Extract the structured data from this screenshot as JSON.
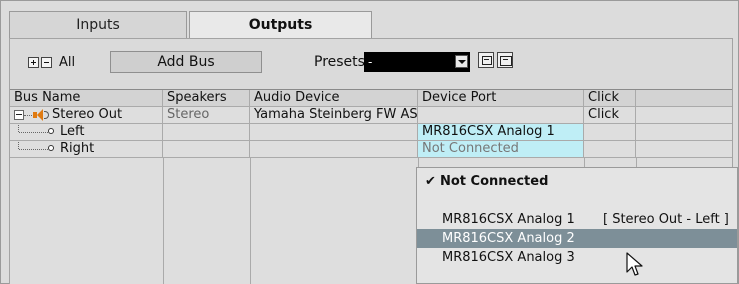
{
  "tabs": [
    {
      "label": "Inputs",
      "active": false
    },
    {
      "label": "Outputs",
      "active": true
    }
  ],
  "toolbar": {
    "all_label": "All",
    "add_bus_label": "Add Bus",
    "presets_label": "Presets",
    "preset_value": "-"
  },
  "table": {
    "headers": [
      "Bus Name",
      "Speakers",
      "Audio Device",
      "Device Port",
      "Click"
    ],
    "rows": [
      {
        "name": "Stereo Out",
        "speakers": "Stereo",
        "device": "Yamaha Steinberg FW ASIO",
        "port": "",
        "click": "Click"
      },
      {
        "name": "Left",
        "speakers": "",
        "device": "",
        "port": "MR816CSX Analog 1",
        "click": ""
      },
      {
        "name": "Right",
        "speakers": "",
        "device": "",
        "port": "Not Connected",
        "click": ""
      }
    ]
  },
  "dropdown": {
    "items": [
      {
        "label": "Not Connected",
        "checked": true,
        "bold": true,
        "assignment": ""
      },
      {
        "label": "MR816CSX Analog 1",
        "checked": false,
        "bold": false,
        "assignment": "[ Stereo Out - Left ]"
      },
      {
        "label": "MR816CSX Analog 2",
        "checked": false,
        "bold": false,
        "assignment": "",
        "highlighted": true
      },
      {
        "label": "MR816CSX Analog 3",
        "checked": false,
        "bold": false,
        "assignment": ""
      }
    ],
    "check_glyph": "✔"
  },
  "colors": {
    "selected_cell": "#bfeef6",
    "menu_highlight": "#7d8f98",
    "speaker_icon": "#e07a10"
  }
}
